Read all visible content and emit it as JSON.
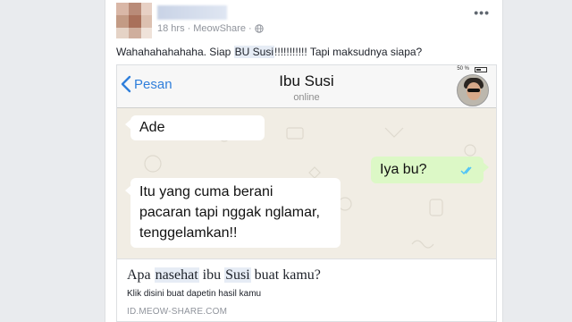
{
  "post": {
    "timestamp": "18 hrs",
    "separator": "·",
    "source": "MeowShare",
    "separator2": "·",
    "text_before": "Wahahahahahaha. Siap ",
    "text_highlight": "BU Susi",
    "text_after": "!!!!!!!!!!! Tapi maksudnya siapa?",
    "more_label": "•••"
  },
  "chat": {
    "battery_text": "50 %",
    "back_label": "Pesan",
    "contact_name": "Ibu Susi",
    "contact_status": "online",
    "messages": [
      {
        "direction": "incoming",
        "text": "Ade"
      },
      {
        "direction": "outgoing",
        "text": "Iya bu?"
      },
      {
        "direction": "incoming",
        "lines": [
          "Itu yang cuma berani",
          "pacaran tapi nggak nglamar,",
          "tenggelamkan!!"
        ]
      }
    ]
  },
  "link": {
    "title_part1": "Apa ",
    "title_hl1": "nasehat",
    "title_part2": " ibu ",
    "title_hl2": "Susi",
    "title_part3": " buat kamu?",
    "description": "Klik disini buat dapetin hasil kamu",
    "domain": "ID.MEOW-SHARE.COM"
  },
  "colors": {
    "chat_background": "#f1ede4",
    "outgoing_bubble": "#dcf8c6",
    "ios_blue": "#2f7fdb",
    "facebook_meta": "#90949c"
  },
  "icons": {
    "privacy": "globe-icon",
    "back": "chevron-left-icon",
    "read_receipt": "double-check-icon",
    "options": "more-options-icon"
  }
}
